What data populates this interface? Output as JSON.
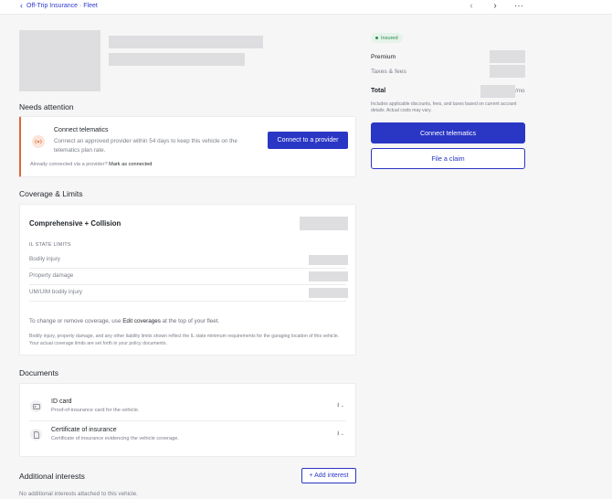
{
  "breadcrumb": {
    "text": "Off-Trip Insurance · Fleet"
  },
  "nav": {
    "prev_icon": "chevron-left-icon",
    "next_icon": "chevron-right-icon",
    "more_icon": "more-horizontal-icon"
  },
  "needs_attention": {
    "title": "Needs attention",
    "card_title": "Connect telematics",
    "card_body": "Connect an approved provider within 54 days to keep this vehicle on the telematics plan rate.",
    "button": "Connect to a provider",
    "footer_text": "Already connected via a provider?",
    "footer_link": "Mark as connected"
  },
  "coverage": {
    "title": "Coverage & Limits",
    "plan_name": "Comprehensive + Collision",
    "state_limits_label": "IL STATE LIMITS",
    "limits": [
      "Bodily injury",
      "Property damage",
      "UM/UIM bodily injury"
    ],
    "change_text_pre": "To change or remove coverage, use",
    "change_link": "Edit coverages",
    "change_text_post": "at the top of your fleet.",
    "disclaimer": "Bodily injury, property damage, and any other liability limits shown reflect the IL state minimum requirements for the garaging location of this vehicle. Your actual coverage limits are set forth in your policy documents."
  },
  "documents": {
    "title": "Documents",
    "items": [
      {
        "name": "ID card",
        "desc": "Proof-of-insurance card for the vehicle.",
        "icon": "id-card-icon"
      },
      {
        "name": "Certificate of insurance",
        "desc": "Certificate of insurance evidencing the vehicle coverage.",
        "icon": "document-icon"
      }
    ]
  },
  "additional_interests": {
    "title": "Additional interests",
    "button": "+ Add interest",
    "empty": "No additional interests attached to this vehicle."
  },
  "summary": {
    "status_badge": "Insured",
    "status_color": "#2f8a4e",
    "premium_label": "Premium",
    "taxes_label": "Taxes & fees",
    "total_label": "Total",
    "total_suffix": "/mo",
    "note": "Includes applicable discounts, fees, and taxes based on current account details. Actual costs may vary.",
    "primary_button": "Connect telematics",
    "secondary_button": "File a claim"
  },
  "colors": {
    "accent": "#2a36c4",
    "warning": "#e0673a"
  }
}
